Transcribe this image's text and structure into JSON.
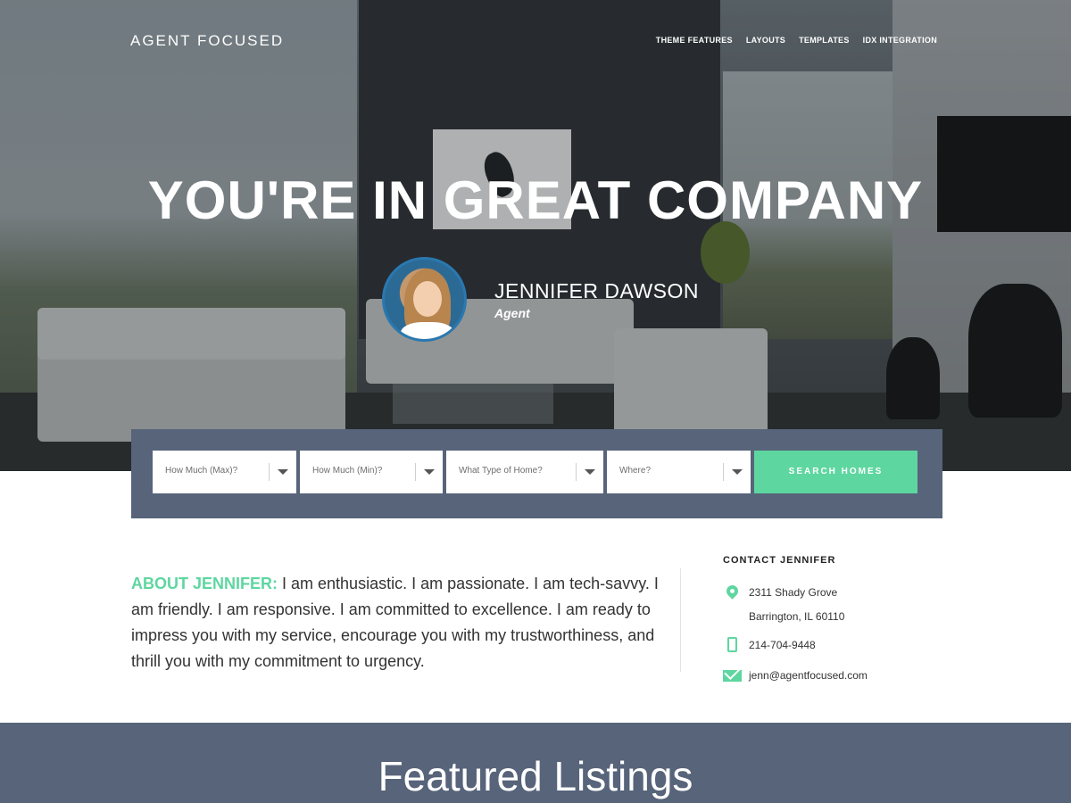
{
  "brand": "AGENT FOCUSED",
  "nav": {
    "items": [
      "THEME FEATURES",
      "LAYOUTS",
      "TEMPLATES",
      "IDX INTEGRATION"
    ]
  },
  "hero": {
    "headline": "YOU'RE IN GREAT COMPANY",
    "agent_name": "JENNIFER DAWSON",
    "agent_title": "Agent"
  },
  "search": {
    "fields": [
      "How Much (Max)?",
      "How Much (Min)?",
      "What Type of Home?",
      "Where?"
    ],
    "button": "SEARCH HOMES"
  },
  "about": {
    "lead": "ABOUT JENNIFER:",
    "text": " I am enthusiastic. I am passionate. I am tech-savvy. I am friendly. I am responsive. I am committed to excellence. I am ready to impress you with my service, encourage you with my trustworthiness, and thrill you with my commitment to urgency."
  },
  "contact": {
    "title": "CONTACT JENNIFER",
    "address_line1": "2311 Shady Grove",
    "address_line2": "Barrington, IL 60110",
    "phone": "214-704-9448",
    "email": "jenn@agentfocused.com"
  },
  "featured": {
    "title": "Featured Listings"
  },
  "colors": {
    "accent": "#5ed6a0",
    "panel": "#57647a"
  }
}
